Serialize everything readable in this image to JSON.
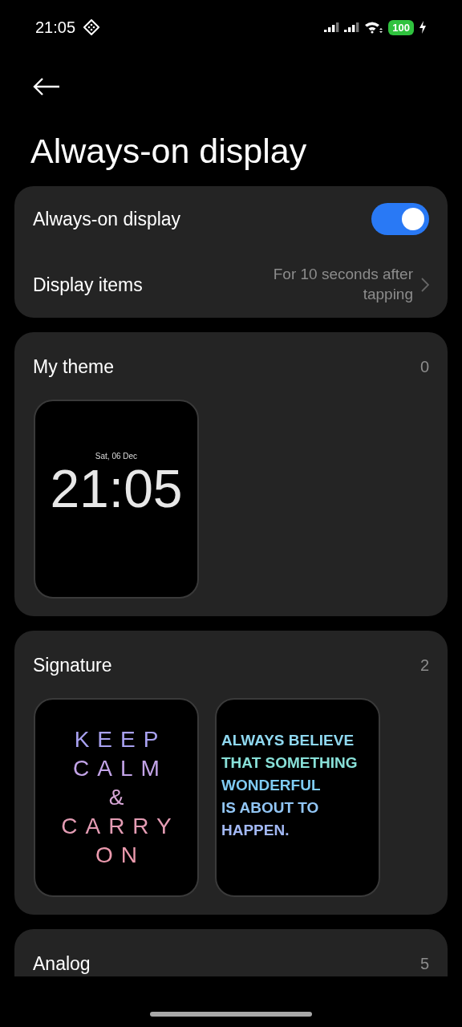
{
  "status_bar": {
    "time": "21:05",
    "battery": "100"
  },
  "title": "Always-on display",
  "settings": [
    {
      "kind": "toggle",
      "label": "Always-on display",
      "on": true
    },
    {
      "kind": "link",
      "label": "Display items",
      "value": "For 10 seconds after tapping"
    }
  ],
  "sections": [
    {
      "title": "My theme",
      "count": "0",
      "items": [
        {
          "kind": "digital",
          "date": "Sat, 06 Dec",
          "time": "21:05"
        }
      ]
    },
    {
      "title": "Signature",
      "count": "2",
      "items": [
        {
          "kind": "spaced",
          "lines": [
            "KEEP",
            "CALM",
            "&",
            "CARRY",
            "ON"
          ]
        },
        {
          "kind": "bold",
          "lines": [
            "ALWAYS BELIEVE",
            "THAT SOMETHING",
            "WONDERFUL",
            "IS ABOUT TO",
            "HAPPEN."
          ]
        }
      ]
    },
    {
      "title": "Analog",
      "count": "5"
    }
  ]
}
